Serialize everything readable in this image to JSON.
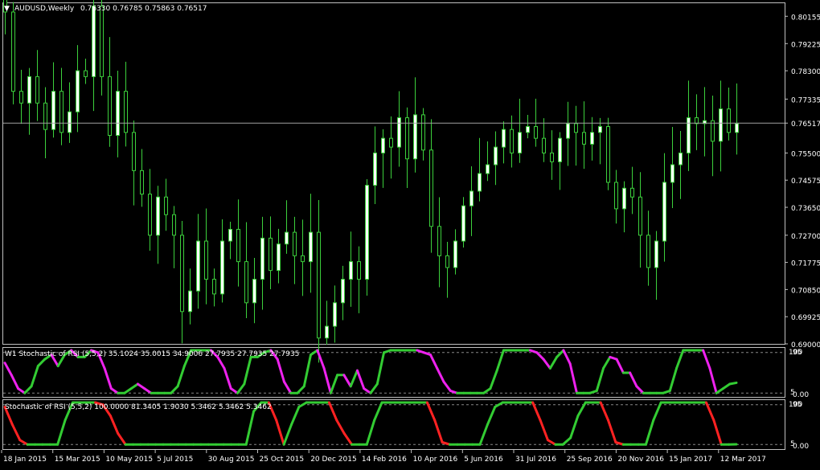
{
  "header": {
    "symbol_title": "AUDUSD,Weekly",
    "ohlc": "0.76330 0.76785 0.75863 0.76517"
  },
  "main_axis": {
    "ticks": [
      "0.80155",
      "0.79225",
      "0.78300",
      "0.77335",
      "0.76517",
      "0.75500",
      "0.74575",
      "0.73650",
      "0.72700",
      "0.71775",
      "0.70850",
      "0.69925",
      "0.69000"
    ],
    "current_price": "0.76517"
  },
  "indicator1": {
    "title": "W1 Stochastic of RSI (5,5,2) 35.1024 35.0015 34.9006 27.7935 27.7935 27.7935",
    "axis_top": "100",
    "axis_top_level": "95",
    "axis_bottom_level": "5",
    "axis_bottom": "0.00"
  },
  "indicator2": {
    "title": "Stochastic of RSI (5,5,2) 100.0000 81.3405 1.9030 5.3462 5.3462 5.3462",
    "axis_top": "100",
    "axis_top_level": "95",
    "axis_bottom_level": "5",
    "axis_bottom": "0.00"
  },
  "time_axis": {
    "labels": [
      "18 Jan 2015",
      "15 Mar 2015",
      "10 May 2015",
      "5 Jul 2015",
      "30 Aug 2015",
      "25 Oct 2015",
      "20 Dec 2015",
      "14 Feb 2016",
      "10 Apr 2016",
      "5 Jun 2016",
      "31 Jul 2016",
      "25 Sep 2016",
      "20 Nov 2016",
      "15 Jan 2017",
      "12 Mar 2017"
    ]
  },
  "colors": {
    "background": "#000000",
    "frame": "#c0c0c0",
    "bull_candle": "#ffffff",
    "bear_candle": "#000000",
    "wick": "#3cd03c",
    "rising": "#33cc33",
    "falling_indicator1": "#ee22ee",
    "falling_indicator2": "#ff2222",
    "level_line": "#888888"
  },
  "chart_data": [
    {
      "type": "candlestick",
      "title": "AUDUSD,Weekly",
      "x_range": [
        "2015-01-04",
        "2017-03-26"
      ],
      "ylim": [
        0.69,
        0.806
      ],
      "current_price": 0.76517,
      "last_bar": {
        "open": 0.7633,
        "high": 0.76785,
        "low": 0.75863,
        "close": 0.76517
      },
      "closes": [
        0.803,
        0.776,
        0.772,
        0.781,
        0.772,
        0.763,
        0.776,
        0.762,
        0.769,
        0.783,
        0.781,
        0.805,
        0.781,
        0.761,
        0.776,
        0.762,
        0.749,
        0.741,
        0.727,
        0.74,
        0.734,
        0.727,
        0.701,
        0.708,
        0.725,
        0.712,
        0.707,
        0.725,
        0.729,
        0.718,
        0.704,
        0.712,
        0.726,
        0.715,
        0.724,
        0.728,
        0.72,
        0.718,
        0.728,
        0.692,
        0.696,
        0.704,
        0.712,
        0.718,
        0.712,
        0.744,
        0.755,
        0.76,
        0.757,
        0.767,
        0.753,
        0.768,
        0.756,
        0.73,
        0.72,
        0.716,
        0.725,
        0.737,
        0.742,
        0.748,
        0.751,
        0.757,
        0.763,
        0.755,
        0.762,
        0.764,
        0.76,
        0.755,
        0.752,
        0.76,
        0.765,
        0.762,
        0.758,
        0.762,
        0.764,
        0.745,
        0.736,
        0.743,
        0.74,
        0.727,
        0.716,
        0.725,
        0.745,
        0.751,
        0.755,
        0.767,
        0.765,
        0.766,
        0.759,
        0.77,
        0.762,
        0.765
      ]
    },
    {
      "type": "line",
      "title": "W1 Stochastic of RSI (5,5,2)",
      "ylim": [
        0,
        100
      ],
      "levels": [
        5,
        95
      ],
      "last_values": [
        35.1024,
        35.0015,
        34.9006,
        27.7935,
        27.7935,
        27.7935
      ],
      "values": [
        72,
        45,
        15,
        5,
        20,
        65,
        80,
        90,
        65,
        90,
        100,
        85,
        85,
        100,
        95,
        60,
        15,
        5,
        5,
        15,
        25,
        15,
        5,
        5,
        5,
        5,
        20,
        65,
        100,
        100,
        100,
        100,
        85,
        60,
        15,
        5,
        25,
        85,
        85,
        95,
        100,
        80,
        30,
        5,
        5,
        20,
        90,
        100,
        60,
        5,
        45,
        45,
        20,
        55,
        15,
        5,
        25,
        95,
        100,
        100,
        100,
        100,
        100,
        95,
        90,
        60,
        30,
        10,
        5,
        5,
        5,
        5,
        5,
        15,
        55,
        100,
        100,
        100,
        100,
        100,
        95,
        80,
        60,
        85,
        100,
        70,
        5,
        5,
        5,
        10,
        60,
        85,
        80,
        50,
        50,
        20,
        5,
        5,
        5,
        5,
        10,
        60,
        100,
        100,
        100,
        100,
        60,
        5,
        15,
        25,
        27.79
      ]
    },
    {
      "type": "line",
      "title": "Stochastic of RSI (5,5,2)",
      "ylim": [
        0,
        100
      ],
      "levels": [
        5,
        95
      ],
      "last_values": [
        100.0,
        81.3405,
        1.903,
        5.3462,
        5.3462,
        5.3462
      ],
      "values": [
        90,
        50,
        15,
        5,
        5,
        5,
        5,
        5,
        60,
        100,
        100,
        100,
        100,
        95,
        70,
        30,
        5,
        5,
        5,
        5,
        5,
        5,
        5,
        5,
        5,
        5,
        5,
        5,
        5,
        5,
        5,
        5,
        5,
        80,
        100,
        100,
        60,
        5,
        50,
        90,
        100,
        100,
        100,
        100,
        60,
        30,
        5,
        5,
        5,
        60,
        100,
        100,
        100,
        100,
        100,
        100,
        100,
        60,
        10,
        5,
        5,
        5,
        5,
        5,
        50,
        90,
        100,
        100,
        100,
        100,
        100,
        60,
        15,
        5,
        5,
        20,
        70,
        100,
        100,
        100,
        60,
        10,
        5,
        5,
        5,
        5,
        60,
        100,
        100,
        100,
        100,
        100,
        100,
        100,
        60,
        5,
        5,
        5.35
      ]
    }
  ]
}
